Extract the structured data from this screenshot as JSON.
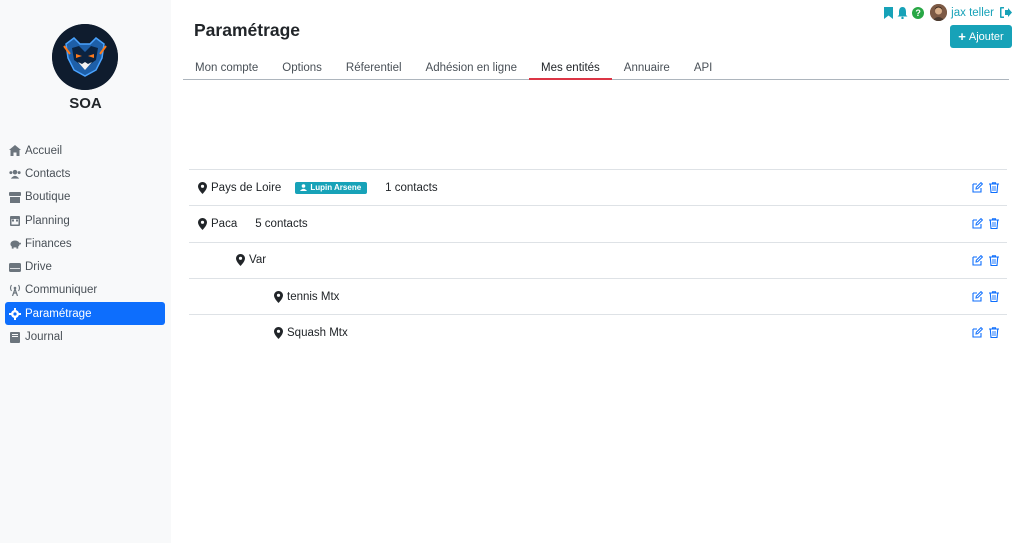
{
  "app": {
    "org_name": "SOA",
    "brand_color": "#0d6efd",
    "accent_color": "#17a2b8"
  },
  "sidebar": {
    "items": [
      {
        "label": "Accueil",
        "icon": "home-icon"
      },
      {
        "label": "Contacts",
        "icon": "users-icon"
      },
      {
        "label": "Boutique",
        "icon": "store-icon"
      },
      {
        "label": "Planning",
        "icon": "calendar-icon"
      },
      {
        "label": "Finances",
        "icon": "piggy-bank-icon"
      },
      {
        "label": "Drive",
        "icon": "hdd-icon"
      },
      {
        "label": "Communiquer",
        "icon": "broadcast-icon"
      },
      {
        "label": "Paramétrage",
        "icon": "gear-icon",
        "active": true
      },
      {
        "label": "Journal",
        "icon": "book-icon"
      }
    ]
  },
  "header": {
    "title": "Paramétrage",
    "username": "jax teller",
    "help_label": "?",
    "add_button": "Ajouter"
  },
  "tabs": [
    {
      "label": "Mon compte"
    },
    {
      "label": "Options"
    },
    {
      "label": "Réferentiel"
    },
    {
      "label": "Adhésion en ligne"
    },
    {
      "label": "Mes entités",
      "active": true
    },
    {
      "label": "Annuaire"
    },
    {
      "label": "API"
    }
  ],
  "entities": [
    {
      "name": "Pays de Loire",
      "level": 0,
      "badge": "Lupin Arsene",
      "count": "1 contacts"
    },
    {
      "name": "Paca",
      "level": 0,
      "badge": "",
      "count": "5 contacts"
    },
    {
      "name": "Var",
      "level": 1,
      "badge": "",
      "count": ""
    },
    {
      "name": "tennis Mtx",
      "level": 2,
      "badge": "",
      "count": ""
    },
    {
      "name": "Squash Mtx",
      "level": 2,
      "badge": "",
      "count": ""
    }
  ]
}
